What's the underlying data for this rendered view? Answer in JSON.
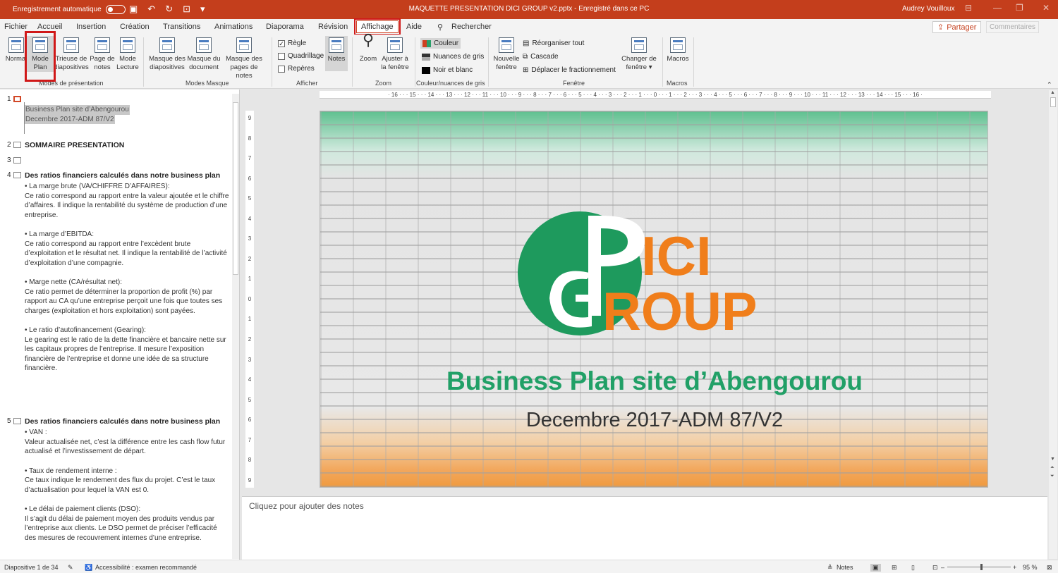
{
  "titlebar": {
    "autosave_label": "Enregistrement automatique",
    "doc_title": "MAQUETTE PRESENTATION DICI GROUP v2.pptx  -  Enregistré dans ce PC",
    "user": "Audrey Vouilloux"
  },
  "tabs": [
    "Fichier",
    "Accueil",
    "Insertion",
    "Création",
    "Transitions",
    "Animations",
    "Diaporama",
    "Révision",
    "Affichage",
    "Aide"
  ],
  "search_label": "Rechercher",
  "share_label": "Partager",
  "comments_label": "Commentaires",
  "ribbon": {
    "presentation_views": {
      "label": "Modes de présentation",
      "normal": "Normal",
      "outline": [
        "Mode",
        "Plan"
      ],
      "sorter": [
        "Trieuse de",
        "diapositives"
      ],
      "notes_page": [
        "Page de",
        "notes"
      ],
      "reading": [
        "Mode",
        "Lecture"
      ]
    },
    "master_views": {
      "label": "Modes Masque",
      "slide_master": [
        "Masque des",
        "diapositives"
      ],
      "handout_master": [
        "Masque du",
        "document"
      ],
      "notes_master": [
        "Masque des",
        "pages de notes"
      ]
    },
    "show": {
      "label": "Afficher",
      "ruler": "Règle",
      "gridlines": "Quadrillage",
      "guides": "Repères",
      "notes": "Notes"
    },
    "zoom": {
      "label": "Zoom",
      "zoom": "Zoom",
      "fit": [
        "Ajuster à",
        "la fenêtre"
      ]
    },
    "color": {
      "label": "Couleur/nuances de gris",
      "color": "Couleur",
      "grayscale": "Nuances de gris",
      "bw": "Noir et blanc"
    },
    "window": {
      "label": "Fenêtre",
      "new": [
        "Nouvelle",
        "fenêtre"
      ],
      "arrange": "Réorganiser tout",
      "cascade": "Cascade",
      "move_split": "Déplacer le fractionnement",
      "switch": [
        "Changer de",
        "fenêtre ▾"
      ]
    },
    "macros": {
      "label": "Macros",
      "macros": "Macros"
    }
  },
  "outline": {
    "s1": {
      "num": "1",
      "line1": "Business Plan site d’Abengourou",
      "line2": "Decembre 2017-ADM 87/V2"
    },
    "s2": {
      "num": "2",
      "title": "SOMMAIRE PRESENTATION"
    },
    "s3": {
      "num": "3"
    },
    "s4": {
      "num": "4",
      "title": "Des ratios financiers calculés dans notre business plan",
      "p1": "• La marge brute (VA/CHIFFRE D’AFFAIRES):",
      "p2": "Ce ratio correspond au rapport entre la valeur ajoutée et le chiffre d’affaires. Il indique la rentabilité du système de production d’une entreprise.",
      "p3": "• La marge d’EBITDA:",
      "p4": "Ce ratio correspond au rapport entre l’excèdent brute d’exploitation et le résultat net. Il indique la rentabilité de l’activité d’exploitation d’une compagnie.",
      "p5": "• Marge nette (CA/résultat net):",
      "p6": "Ce ratio permet de déterminer la proportion de profit (%) par rapport au CA qu’une entreprise perçoit une fois que toutes ses charges (exploitation et hors exploitation) sont payées.",
      "p7": "• Le ratio d’autofinancement (Gearing):",
      "p8": "Le gearing est le ratio de la dette financière et bancaire nette sur les capitaux propres de l’entreprise. Il mesure l’exposition financière de l’entreprise et donne une idée de sa structure financière."
    },
    "s5": {
      "num": "5",
      "title": "Des ratios financiers calculés dans notre business plan",
      "p1": "• VAN :",
      "p2": "Valeur actualisée net, c’est la différence entre les cash flow futur actualisé et l’investissement de départ.",
      "p3": "• Taux de rendement interne :",
      "p4": "Ce taux indique le rendement des flux du projet. C’est le taux d’actualisation pour lequel la VAN est 0.",
      "p5": "• Le délai de paiement clients (DSO):",
      "p6": "Il s’agit du délai de paiement moyen des produits vendus par l’entreprise aux clients. Le DSO permet de préciser l’efficacité des mesures de recouvrement internes d’une entreprise."
    }
  },
  "ruler_h": "· 16 · · · 15 · · · 14 · · · 13 · · · 12 · · · 11 · · · 10 · · · 9 · · · 8 · · · 7 · · · 6 · · · 5 · · · 4 · · · 3 · · · 2 · · · 1 · · · 0 · · · 1 · · · 2 · · · 3 · · · 4 · · · 5 · · · 6 · · · 7 · · · 8 · · · 9 · · · 10 · · · 11 · · · 12 · · · 13 · · · 14 · · · 15 · · · 16 ·",
  "ruler_v": [
    "9",
    "8",
    "7",
    "6",
    "5",
    "4",
    "3",
    "2",
    "1",
    "0",
    "1",
    "2",
    "3",
    "4",
    "5",
    "6",
    "7",
    "8",
    "9"
  ],
  "slide": {
    "logo_top": "ICI",
    "logo_bottom": "ROUP",
    "title": "Business Plan site d’Abengourou",
    "subtitle": "Decembre 2017-ADM 87/V2"
  },
  "notes_placeholder": "Cliquez pour ajouter des notes",
  "status": {
    "slide_count": "Diapositive 1 de 34",
    "accessibility": "Accessibilité : examen recommandé",
    "notes": "Notes",
    "zoom": "95 %"
  },
  "colors": {
    "accent": "#c43e1c",
    "green": "#21a067",
    "orange": "#f07e1b",
    "highlight": "#d01818"
  }
}
